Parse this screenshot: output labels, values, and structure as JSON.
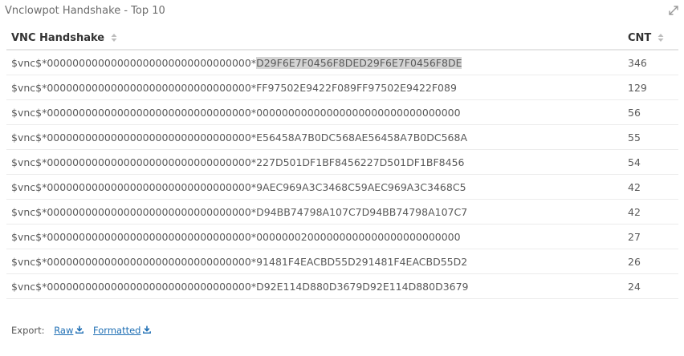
{
  "panel": {
    "title": "Vnclowpot Handshake - Top 10",
    "icons": {
      "expand": "expand-arrows-icon"
    }
  },
  "table": {
    "headers": {
      "handshake": "VNC Handshake",
      "count": "CNT"
    },
    "rows": [
      {
        "prefix": "$vnc$*00000000000000000000000000000000*",
        "suffix": "D29F6E7F0456F8DED29F6E7F0456F8DE",
        "count": "346",
        "highlighted": true
      },
      {
        "prefix": "$vnc$*00000000000000000000000000000000*",
        "suffix": "FF97502E9422F089FF97502E9422F089",
        "count": "129"
      },
      {
        "prefix": "$vnc$*00000000000000000000000000000000*",
        "suffix": "00000000000000000000000000000000",
        "count": "56"
      },
      {
        "prefix": "$vnc$*00000000000000000000000000000000*",
        "suffix": "E56458A7B0DC568AE56458A7B0DC568A",
        "count": "55"
      },
      {
        "prefix": "$vnc$*00000000000000000000000000000000*",
        "suffix": "227D501DF1BF8456227D501DF1BF8456",
        "count": "54"
      },
      {
        "prefix": "$vnc$*00000000000000000000000000000000*",
        "suffix": "9AEC969A3C3468C59AEC969A3C3468C5",
        "count": "42"
      },
      {
        "prefix": "$vnc$*00000000000000000000000000000000*",
        "suffix": "D94BB74798A107C7D94BB74798A107C7",
        "count": "42"
      },
      {
        "prefix": "$vnc$*00000000000000000000000000000000*",
        "suffix": "00000002000000000000000000000000",
        "count": "27"
      },
      {
        "prefix": "$vnc$*00000000000000000000000000000000*",
        "suffix": "91481F4EACBD55D291481F4EACBD55D2",
        "count": "26"
      },
      {
        "prefix": "$vnc$*00000000000000000000000000000000*",
        "suffix": "D92E114D880D3679D92E114D880D3679",
        "count": "24"
      }
    ]
  },
  "export": {
    "label": "Export:",
    "raw": "Raw",
    "formatted": "Formatted",
    "icon": "download-icon"
  },
  "colors": {
    "link": "#1f6fb4",
    "highlight": "#d4d4d4",
    "header_border": "#e6e6e6"
  }
}
